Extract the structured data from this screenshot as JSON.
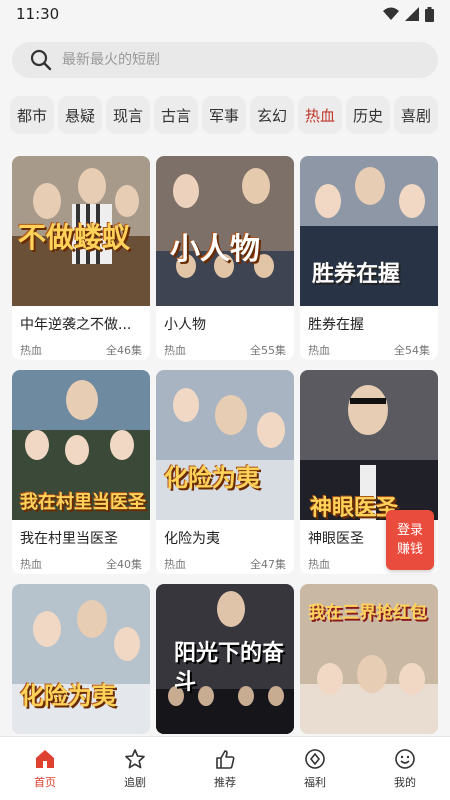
{
  "status": {
    "time": "11:30"
  },
  "search": {
    "placeholder": "最新最火的短剧"
  },
  "tabs": [
    {
      "label": "都市",
      "active": false
    },
    {
      "label": "悬疑",
      "active": false
    },
    {
      "label": "现言",
      "active": false
    },
    {
      "label": "古言",
      "active": false
    },
    {
      "label": "军事",
      "active": false
    },
    {
      "label": "玄幻",
      "active": false
    },
    {
      "label": "热血",
      "active": true
    },
    {
      "label": "历史",
      "active": false
    },
    {
      "label": "喜剧",
      "active": false
    }
  ],
  "cards": [
    {
      "title": "中年逆袭之不做...",
      "genre": "热血",
      "episodes": "全46集",
      "poster_text": "不做蝼蚁",
      "poster_color": "#8a6a4a"
    },
    {
      "title": "小人物",
      "genre": "热血",
      "episodes": "全55集",
      "poster_text": "小人物",
      "poster_color": "#5b5048"
    },
    {
      "title": "胜券在握",
      "genre": "热血",
      "episodes": "全54集",
      "poster_text": "胜券在握",
      "poster_color": "#3a4658"
    },
    {
      "title": "我在村里当医圣",
      "genre": "热血",
      "episodes": "全40集",
      "poster_text": "我在村里当医圣",
      "poster_color": "#6b7a86"
    },
    {
      "title": "化险为夷",
      "genre": "热血",
      "episodes": "全47集",
      "poster_text": "化险为夷",
      "poster_color": "#7a8a9a"
    },
    {
      "title": "神眼医圣",
      "genre": "热血",
      "episodes": "",
      "poster_text": "神眼医圣",
      "poster_color": "#4a4a52"
    },
    {
      "title": "",
      "genre": "",
      "episodes": "",
      "poster_text": "化险为夷",
      "poster_color": "#8a9aa6"
    },
    {
      "title": "",
      "genre": "",
      "episodes": "",
      "poster_text": "阳光下的奋斗",
      "poster_color": "#2c2c30"
    },
    {
      "title": "",
      "genre": "",
      "episodes": "",
      "poster_text": "我在三界抢红包",
      "poster_color": "#9a8a7a"
    }
  ],
  "login_badge": {
    "line1": "登录",
    "line2": "赚钱"
  },
  "bottom_nav": [
    {
      "label": "首页",
      "icon": "home-icon",
      "active": true
    },
    {
      "label": "追剧",
      "icon": "star-icon",
      "active": false
    },
    {
      "label": "推荐",
      "icon": "thumbs-up-icon",
      "active": false
    },
    {
      "label": "福利",
      "icon": "diamond-icon",
      "active": false
    },
    {
      "label": "我的",
      "icon": "smile-icon",
      "active": false
    }
  ],
  "colors": {
    "accent": "#e04030",
    "active_tab": "#c0392b"
  }
}
